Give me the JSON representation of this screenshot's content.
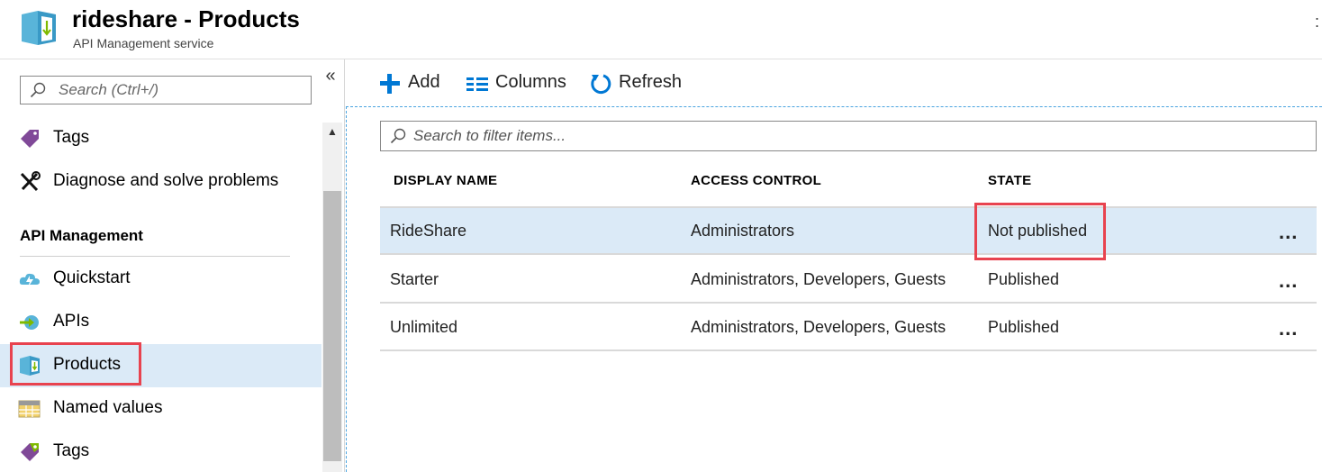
{
  "header": {
    "title": "rideshare - Products",
    "subtitle": "API Management service",
    "close_glyph": ":",
    "logo_icon": "product-cube-icon"
  },
  "sidebar": {
    "search_placeholder": "Search (Ctrl+/)",
    "collapse_glyph": "«",
    "scroll_up_glyph": "▲",
    "items_top": [
      {
        "label": "Tags",
        "icon": "tag-icon"
      },
      {
        "label": "Diagnose and solve problems",
        "icon": "wrench-screwdriver-icon"
      }
    ],
    "section_heading": "API Management",
    "items": [
      {
        "label": "Quickstart",
        "icon": "cloud-lightning-icon"
      },
      {
        "label": "APIs",
        "icon": "api-arrow-icon"
      },
      {
        "label": "Products",
        "icon": "product-cube-icon",
        "active": true
      },
      {
        "label": "Named values",
        "icon": "table-grid-icon"
      },
      {
        "label": "Tags",
        "icon": "tag-icon"
      }
    ]
  },
  "toolbar": {
    "add_label": "Add",
    "columns_label": "Columns",
    "refresh_label": "Refresh"
  },
  "filter": {
    "placeholder": "Search to filter items..."
  },
  "table": {
    "columns": [
      "DISPLAY NAME",
      "ACCESS CONTROL",
      "STATE"
    ],
    "rows": [
      {
        "name": "RideShare",
        "access": "Administrators",
        "state": "Not published",
        "selected": true,
        "more": "..."
      },
      {
        "name": "Starter",
        "access": "Administrators, Developers, Guests",
        "state": "Published",
        "more": "..."
      },
      {
        "name": "Unlimited",
        "access": "Administrators, Developers, Guests",
        "state": "Published",
        "more": "..."
      }
    ]
  },
  "colors": {
    "accent_blue": "#0078d4",
    "selection_bg": "#dbeaf7",
    "highlight_red": "#e8434f"
  }
}
